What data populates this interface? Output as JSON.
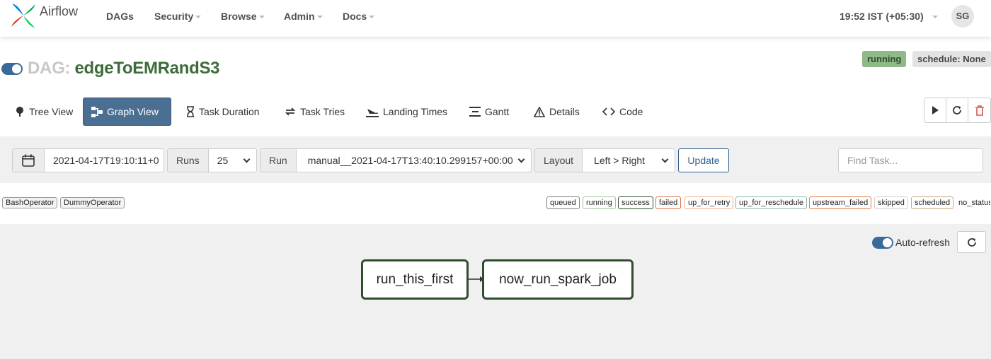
{
  "navbar": {
    "brand": "Airflow",
    "items": [
      {
        "label": "DAGs",
        "dropdown": false
      },
      {
        "label": "Security",
        "dropdown": true
      },
      {
        "label": "Browse",
        "dropdown": true
      },
      {
        "label": "Admin",
        "dropdown": true
      },
      {
        "label": "Docs",
        "dropdown": true
      }
    ],
    "time": "19:52 IST (+05:30)",
    "avatar": "SG"
  },
  "dag": {
    "prefix": "DAG:",
    "id": "edgeToEMRandS3",
    "paused": false,
    "status": "running",
    "schedule": "schedule: None"
  },
  "tabs": [
    {
      "label": "Tree View",
      "icon": "tree-icon",
      "active": false
    },
    {
      "label": "Graph View",
      "icon": "graph-icon",
      "active": true
    },
    {
      "label": "Task Duration",
      "icon": "hourglass-icon",
      "active": false
    },
    {
      "label": "Task Tries",
      "icon": "retry-icon",
      "active": false
    },
    {
      "label": "Landing Times",
      "icon": "landing-icon",
      "active": false
    },
    {
      "label": "Gantt",
      "icon": "gantt-icon",
      "active": false
    },
    {
      "label": "Details",
      "icon": "warning-icon",
      "active": false
    },
    {
      "label": "Code",
      "icon": "code-icon",
      "active": false
    }
  ],
  "filters": {
    "date": "2021-04-17T19:10:11+0",
    "runs_label": "Runs",
    "runs_value": "25",
    "run_label": "Run",
    "run_value": "manual__2021-04-17T13:40:10.299157+00:00",
    "layout_label": "Layout",
    "layout_value": "Left > Right",
    "update": "Update",
    "find_placeholder": "Find Task..."
  },
  "operators": [
    "BashOperator",
    "DummyOperator"
  ],
  "states": [
    {
      "label": "queued",
      "color": "#808080"
    },
    {
      "label": "running",
      "color": "#9fc59a"
    },
    {
      "label": "success",
      "color": "#2f4f2f"
    },
    {
      "label": "failed",
      "color": "#e0734a"
    },
    {
      "label": "up_for_retry",
      "color": "#f0b08f"
    },
    {
      "label": "up_for_reschedule",
      "color": "#8cb9a7"
    },
    {
      "label": "upstream_failed",
      "color": "#e07a44"
    },
    {
      "label": "skipped",
      "color": "#d0d0d0"
    },
    {
      "label": "scheduled",
      "color": "#c8a87a"
    },
    {
      "label": "no_status",
      "color": "#ffffff"
    }
  ],
  "graph": {
    "autorefresh": "Auto-refresh",
    "nodes": [
      "run_this_first",
      "now_run_spark_job"
    ]
  },
  "colors": {
    "success_border": "#2e4e2e",
    "active_tab": "#4b6f93",
    "dag_title": "#3d6b3b"
  }
}
